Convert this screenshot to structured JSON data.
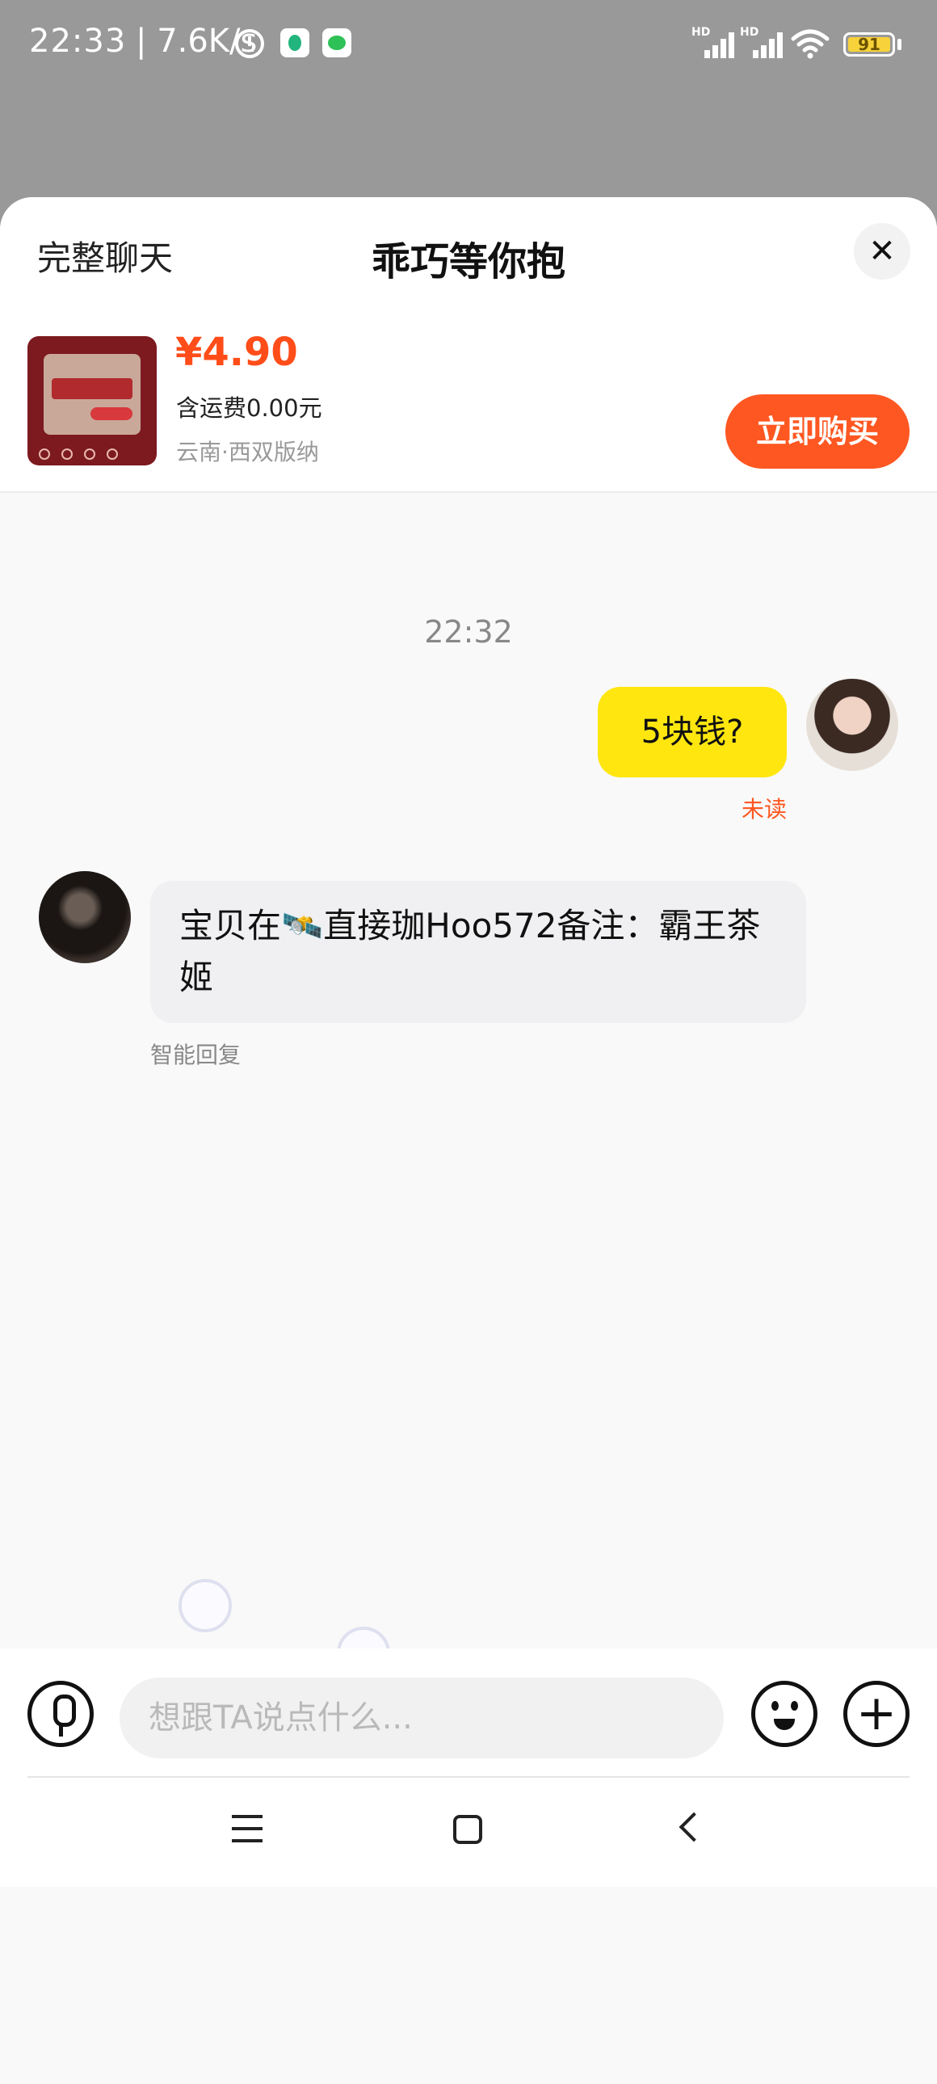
{
  "status_bar": {
    "time": "22:33",
    "network_speed": "| 7.6K/s",
    "signal_label": "HD",
    "battery": "91",
    "battery_color": "#f7d23a"
  },
  "header": {
    "full_chat_label": "完整聊天",
    "title": "乖巧等你抱",
    "close_icon": "close-icon"
  },
  "product": {
    "price": "¥4.90",
    "shipping": "含运费0.00元",
    "location": "云南·西双版纳",
    "buy_label": "立即购买",
    "accent_color": "#ff5722"
  },
  "chat": {
    "timestamp": "22:32",
    "messages": [
      {
        "sender": "me",
        "text": "5块钱?",
        "status": "未读"
      },
      {
        "sender": "other",
        "text": "宝贝在🛰️直接珈Hoo572备注：霸王茶姬",
        "note": "智能回复"
      }
    ]
  },
  "input_bar": {
    "placeholder": "想跟TA说点什么...",
    "value": "",
    "plus_label": "+"
  },
  "watermark": "..."
}
